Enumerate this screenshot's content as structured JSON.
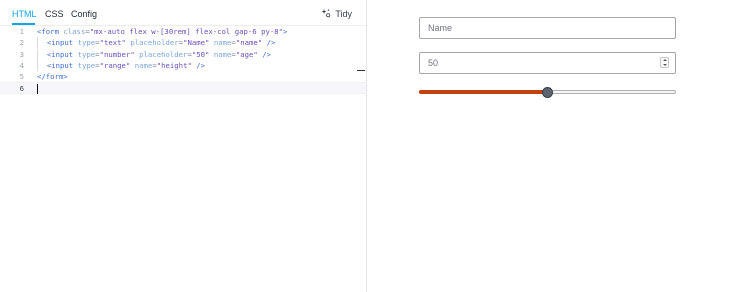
{
  "tabs": [
    {
      "label": "HTML",
      "active": true
    },
    {
      "label": "CSS",
      "active": false
    },
    {
      "label": "Config",
      "active": false
    }
  ],
  "toolbar": {
    "tidy_label": "Tidy",
    "tidy_icon": "sparkle-icon"
  },
  "editor": {
    "line_numbers": [
      "1",
      "2",
      "3",
      "4",
      "5",
      "6"
    ],
    "current_line": 6,
    "lines": [
      {
        "indent": 0,
        "tokens": [
          {
            "c": "t",
            "s": "<form"
          },
          {
            "c": "x",
            "s": " "
          },
          {
            "c": "a",
            "s": "class"
          },
          {
            "c": "p",
            "s": "="
          },
          {
            "c": "v",
            "s": "\"mx-auto flex w-[30rem] flex-col gap-6 py-8\""
          },
          {
            "c": "t",
            "s": ">"
          }
        ]
      },
      {
        "indent": 1,
        "tokens": [
          {
            "c": "t",
            "s": "<input"
          },
          {
            "c": "x",
            "s": " "
          },
          {
            "c": "a",
            "s": "type"
          },
          {
            "c": "p",
            "s": "="
          },
          {
            "c": "v",
            "s": "\"text\""
          },
          {
            "c": "x",
            "s": " "
          },
          {
            "c": "a",
            "s": "placeholder"
          },
          {
            "c": "p",
            "s": "="
          },
          {
            "c": "v",
            "s": "\"Name\""
          },
          {
            "c": "x",
            "s": " "
          },
          {
            "c": "a",
            "s": "name"
          },
          {
            "c": "p",
            "s": "="
          },
          {
            "c": "v",
            "s": "\"name\""
          },
          {
            "c": "x",
            "s": " "
          },
          {
            "c": "t",
            "s": "/>"
          }
        ]
      },
      {
        "indent": 1,
        "tokens": [
          {
            "c": "t",
            "s": "<input"
          },
          {
            "c": "x",
            "s": " "
          },
          {
            "c": "a",
            "s": "type"
          },
          {
            "c": "p",
            "s": "="
          },
          {
            "c": "v",
            "s": "\"number\""
          },
          {
            "c": "x",
            "s": " "
          },
          {
            "c": "a",
            "s": "placeholder"
          },
          {
            "c": "p",
            "s": "="
          },
          {
            "c": "v",
            "s": "\"50\""
          },
          {
            "c": "x",
            "s": " "
          },
          {
            "c": "a",
            "s": "name"
          },
          {
            "c": "p",
            "s": "="
          },
          {
            "c": "v",
            "s": "\"age\""
          },
          {
            "c": "x",
            "s": " "
          },
          {
            "c": "t",
            "s": "/>"
          }
        ]
      },
      {
        "indent": 1,
        "tokens": [
          {
            "c": "t",
            "s": "<input"
          },
          {
            "c": "x",
            "s": " "
          },
          {
            "c": "a",
            "s": "type"
          },
          {
            "c": "p",
            "s": "="
          },
          {
            "c": "v",
            "s": "\"range\""
          },
          {
            "c": "x",
            "s": " "
          },
          {
            "c": "a",
            "s": "name"
          },
          {
            "c": "p",
            "s": "="
          },
          {
            "c": "v",
            "s": "\"height\""
          },
          {
            "c": "x",
            "s": " "
          },
          {
            "c": "t",
            "s": "/>"
          }
        ]
      },
      {
        "indent": 0,
        "tokens": [
          {
            "c": "t",
            "s": "</form>"
          }
        ]
      },
      {
        "indent": 0,
        "tokens": []
      }
    ]
  },
  "preview": {
    "name_input": {
      "value": "",
      "placeholder": "Name"
    },
    "age_input": {
      "value": "",
      "placeholder": "50"
    },
    "height_range": {
      "value_fraction": 0.5
    },
    "accent_color": "#c2410c"
  },
  "colors": {
    "active_tab": "#0ea5e9",
    "tag": "#3f6fd1",
    "attr": "#7aa7d9",
    "value": "#6b4fbb"
  }
}
